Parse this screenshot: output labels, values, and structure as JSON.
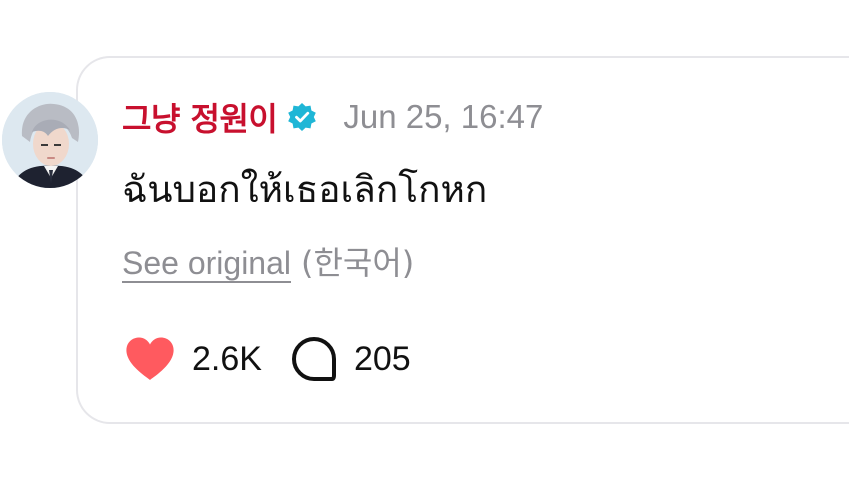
{
  "post": {
    "author": "그냥 정원이",
    "verified_icon": "verified-badge-icon",
    "timestamp": "Jun 25, 16:47",
    "text": "ฉันบอกให้เธอเลิกโกหก",
    "see_original_label": "See original",
    "original_language": "(한국어)",
    "likes": "2.6K",
    "replies": "205"
  },
  "colors": {
    "author": "#c8102e",
    "verified": "#1fb6d6",
    "muted": "#8e8e93",
    "heart": "#ff5a5f",
    "text": "#111111"
  }
}
